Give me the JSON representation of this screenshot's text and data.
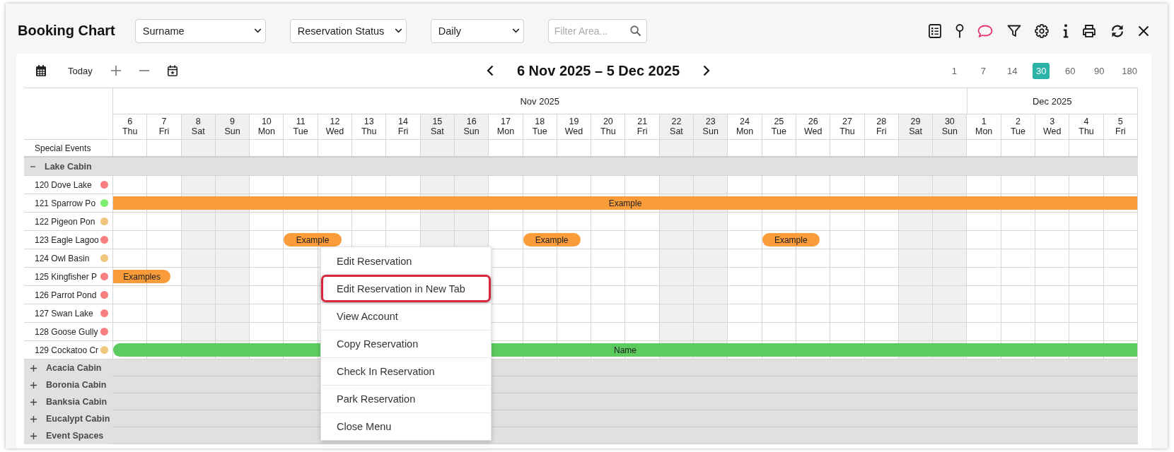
{
  "window": {
    "title": "Booking Chart"
  },
  "filters": [
    {
      "value": "Surname"
    },
    {
      "value": "Reservation Status"
    },
    {
      "value": "Daily"
    }
  ],
  "search": {
    "placeholder": "Filter Area..."
  },
  "toolbar": {
    "today": "Today",
    "period": "6 Nov 2025 – 5 Dec 2025",
    "ranges": [
      {
        "label": "1",
        "selected": false
      },
      {
        "label": "7",
        "selected": false
      },
      {
        "label": "14",
        "selected": false
      },
      {
        "label": "30",
        "selected": true
      },
      {
        "label": "60",
        "selected": false
      },
      {
        "label": "90",
        "selected": false
      },
      {
        "label": "180",
        "selected": false
      }
    ]
  },
  "timeline": {
    "months": [
      {
        "label": "Nov 2025",
        "days": [
          {
            "day": "6",
            "weekday": "Thu",
            "weekend": false
          },
          {
            "day": "7",
            "weekday": "Fri",
            "weekend": false
          },
          {
            "day": "8",
            "weekday": "Sat",
            "weekend": true
          },
          {
            "day": "9",
            "weekday": "Sun",
            "weekend": true
          },
          {
            "day": "10",
            "weekday": "Mon",
            "weekend": false
          },
          {
            "day": "11",
            "weekday": "Tue",
            "weekend": false
          },
          {
            "day": "12",
            "weekday": "Wed",
            "weekend": false
          },
          {
            "day": "13",
            "weekday": "Thu",
            "weekend": false
          },
          {
            "day": "14",
            "weekday": "Fri",
            "weekend": false
          },
          {
            "day": "15",
            "weekday": "Sat",
            "weekend": true
          },
          {
            "day": "16",
            "weekday": "Sun",
            "weekend": true
          },
          {
            "day": "17",
            "weekday": "Mon",
            "weekend": false
          },
          {
            "day": "18",
            "weekday": "Tue",
            "weekend": false
          },
          {
            "day": "19",
            "weekday": "Wed",
            "weekend": false
          },
          {
            "day": "20",
            "weekday": "Thu",
            "weekend": false
          },
          {
            "day": "21",
            "weekday": "Fri",
            "weekend": false
          },
          {
            "day": "22",
            "weekday": "Sat",
            "weekend": true
          },
          {
            "day": "23",
            "weekday": "Sun",
            "weekend": true
          },
          {
            "day": "24",
            "weekday": "Mon",
            "weekend": false
          },
          {
            "day": "25",
            "weekday": "Tue",
            "weekend": false
          },
          {
            "day": "26",
            "weekday": "Wed",
            "weekend": false
          },
          {
            "day": "27",
            "weekday": "Thu",
            "weekend": false
          },
          {
            "day": "28",
            "weekday": "Fri",
            "weekend": false
          },
          {
            "day": "29",
            "weekday": "Sat",
            "weekend": true
          },
          {
            "day": "30",
            "weekday": "Sun",
            "weekend": true
          }
        ]
      },
      {
        "label": "Dec 2025",
        "days": [
          {
            "day": "1",
            "weekday": "Mon",
            "weekend": false
          },
          {
            "day": "2",
            "weekday": "Tue",
            "weekend": false
          },
          {
            "day": "3",
            "weekday": "Wed",
            "weekend": false
          },
          {
            "day": "4",
            "weekday": "Thu",
            "weekend": false
          },
          {
            "day": "5",
            "weekday": "Fri",
            "weekend": false
          }
        ]
      }
    ],
    "special_events": "Special Events",
    "groups": [
      {
        "name": "Lake Cabin",
        "expanded": true,
        "rooms": [
          {
            "name": "120 Dove Lake",
            "color": "#f77f7f"
          },
          {
            "name": "121 Sparrow Po",
            "color": "#7ded6f",
            "days": [
              {
                "booked": true
              }
            ],
            "bookings": [
              {
                "label": "Example",
                "color": "#fa9c3a",
                "continues_before": true,
                "continues_after": true
              }
            ]
          },
          {
            "name": "122 Pigeon Pon",
            "color": "#f0c67c"
          },
          {
            "name": "123 Eagle Lagoo",
            "color": "#f77f7f",
            "days": [
              {
                "booked": false
              },
              {
                "booked": false
              },
              {
                "booked": false
              },
              {
                "booked": false
              },
              {
                "booked": false
              },
              {
                "booked": true
              },
              {
                "booked": true
              },
              {
                "booked": false
              },
              {
                "booked": false
              },
              {
                "booked": false
              },
              {
                "booked": false
              },
              {
                "booked": false
              },
              {
                "booked": true
              },
              {
                "booked": true
              },
              {
                "booked": false
              },
              {
                "booked": false
              },
              {
                "booked": false
              },
              {
                "booked": false
              },
              {
                "booked": false
              },
              {
                "booked": true
              },
              {
                "booked": true
              }
            ],
            "bookings": [
              {
                "label": "Example",
                "color": "#fa9c3a",
                "continues_before": false,
                "continues_after": false
              },
              {
                "label": "Example",
                "color": "#fa9c3a",
                "continues_before": false,
                "continues_after": false
              },
              {
                "label": "Example",
                "color": "#fa9c3a",
                "continues_before": false,
                "continues_after": false
              }
            ]
          },
          {
            "name": "124 Owl Basin",
            "color": "#f0c67c"
          },
          {
            "name": "125 Kingfisher P",
            "color": "#f77f7f",
            "days": [
              {
                "booked": true
              },
              {
                "booked": true
              }
            ],
            "bookings": [
              {
                "label": "Examples",
                "color": "#fa9c3a",
                "continues_before": true,
                "continues_after": false
              }
            ]
          },
          {
            "name": "126 Parrot Pond",
            "color": "#f77f7f"
          },
          {
            "name": "127 Swan Lake",
            "color": "#f77f7f"
          },
          {
            "name": "128 Goose Gully",
            "color": "#f77f7f"
          },
          {
            "name": "129 Cockatoo Cr",
            "color": "#f0c67c",
            "days": [
              {
                "booked": true
              }
            ],
            "bookings": [
              {
                "label": "Name",
                "color": "#5dcc5f",
                "continues_before": false,
                "continues_after": true
              }
            ]
          }
        ]
      },
      {
        "name": "Acacia Cabin",
        "expanded": false
      },
      {
        "name": "Boronia Cabin",
        "expanded": false
      },
      {
        "name": "Banksia Cabin",
        "expanded": false
      },
      {
        "name": "Eucalypt Cabin",
        "expanded": false
      },
      {
        "name": "Event Spaces",
        "expanded": false
      }
    ]
  },
  "context_menu": {
    "items": [
      {
        "label": "Edit Reservation",
        "highlighted": false
      },
      {
        "label": "Edit Reservation in New Tab",
        "highlighted": true
      },
      {
        "label": "View Account",
        "highlighted": false
      },
      {
        "label": "Copy Reservation",
        "highlighted": false
      },
      {
        "label": "Check In Reservation",
        "highlighted": false
      },
      {
        "label": "Park Reservation",
        "highlighted": false
      },
      {
        "label": "Close Menu",
        "highlighted": false
      }
    ]
  }
}
